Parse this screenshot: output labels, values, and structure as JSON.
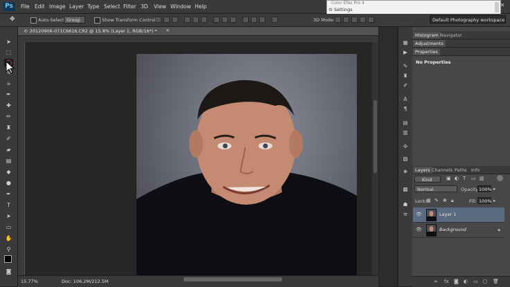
{
  "app": {
    "logo": "Ps"
  },
  "menu": [
    "File",
    "Edit",
    "Image",
    "Layer",
    "Type",
    "Select",
    "Filter",
    "3D",
    "View",
    "Window",
    "Help"
  ],
  "window_controls": {
    "minimize": "–",
    "maximize": "□",
    "close": "✕"
  },
  "popup": {
    "line1": "Color Efex Pro 4",
    "line2": "Settings",
    "gear": "⚙"
  },
  "options": {
    "auto_select_label": "Auto-Select:",
    "auto_select_value": "Group",
    "transform_label": "Show Transform Controls",
    "mode_label": "3D Mode:"
  },
  "workspace": "Default Photography workspace",
  "document": {
    "tab_title": "© 20120906-071C6616.CR2 @ 15.8% (Layer 1, RGB/16*) *",
    "zoom": "15.77%",
    "doc_info": "Doc: 106.2M/212.5M"
  },
  "panels": {
    "top_tabs": [
      "Histogram",
      "Navigator"
    ],
    "adjustments": "Adjustments",
    "properties": "Properties",
    "properties_body": "No Properties",
    "layers_tabs": [
      "Layers",
      "Channels",
      "Paths",
      "Info"
    ],
    "filter_kind": "Kind",
    "blend_mode": "Normal",
    "opacity_label": "Opacity:",
    "opacity_value": "100%",
    "lock_label": "Lock:",
    "fill_label": "Fill:",
    "fill_value": "100%",
    "layers": [
      {
        "name": "Layer 1",
        "selected": true,
        "locked": false
      },
      {
        "name": "Background",
        "selected": false,
        "locked": true
      }
    ]
  },
  "colors": {
    "accent": "#0e3a57",
    "selected_layer": "#5a6a80"
  },
  "icons": [
    "ps-logo-icon",
    "move-icon",
    "marquee-icon",
    "lasso-icon",
    "eye-icon",
    "lock-icon",
    "trash-icon",
    "fx-icon"
  ]
}
